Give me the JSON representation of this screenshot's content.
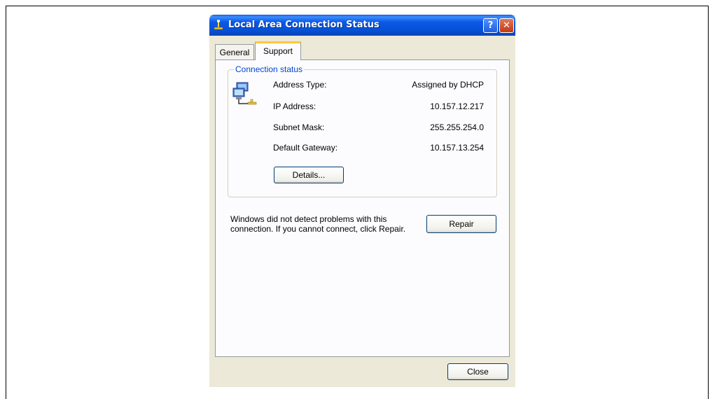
{
  "window": {
    "title": "Local Area Connection Status",
    "help_glyph": "?",
    "close_glyph": "✕"
  },
  "tabs": [
    {
      "label": "General",
      "active": false
    },
    {
      "label": "Support",
      "active": true
    }
  ],
  "connection_status": {
    "legend": "Connection status",
    "rows": [
      {
        "label": "Address Type:",
        "value": "Assigned by DHCP"
      },
      {
        "label": "IP Address:",
        "value": "10.157.12.217"
      },
      {
        "label": "Subnet Mask:",
        "value": "255.255.254.0"
      },
      {
        "label": "Default Gateway:",
        "value": "10.157.13.254"
      }
    ],
    "details_label": "Details..."
  },
  "repair": {
    "message": "Windows did not detect problems with this connection. If you cannot connect, click Repair.",
    "button_label": "Repair"
  },
  "footer": {
    "close_label": "Close"
  },
  "colors": {
    "titlebar": "#0b58e6",
    "group_label": "#0046d5",
    "dialog_bg": "#ece9d8"
  },
  "icons": {
    "title": "network-connection-icon",
    "status": "network-computers-icon"
  }
}
